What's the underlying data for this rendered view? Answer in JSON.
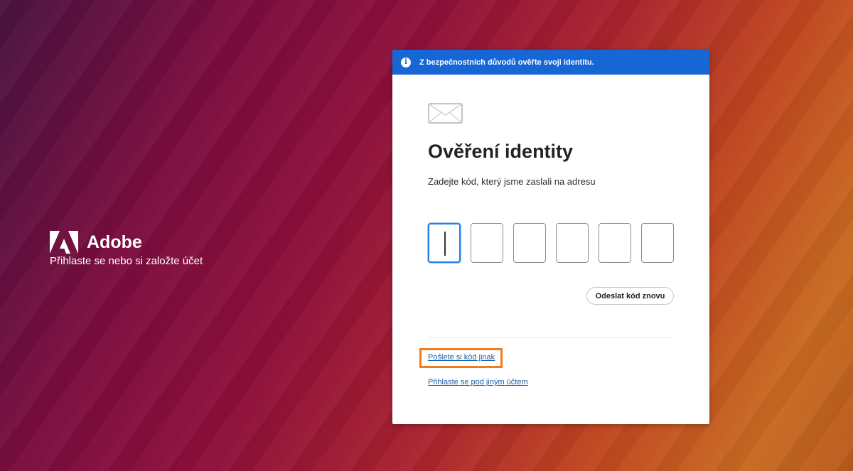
{
  "brand": {
    "name": "Adobe",
    "subtitle": "Přihlaste se nebo si založte účet"
  },
  "banner": {
    "icon": "info-icon",
    "text": "Z bezpečnostních důvodů ověřte svoji identitu."
  },
  "card": {
    "icon": "envelope-icon",
    "title": "Ověření identity",
    "subtitle": "Zadejte kód, který jsme zaslali na adresu",
    "code_fields": [
      "",
      "",
      "",
      "",
      "",
      ""
    ],
    "resend_label": "Odeslat kód znovu",
    "alt_link": "Pošlete si kód jinak",
    "other_account_link": "Přihlaste se pod jiným účtem"
  },
  "colors": {
    "banner": "#1666d6",
    "highlight": "#f07c1c",
    "link": "#1a5fa8"
  }
}
